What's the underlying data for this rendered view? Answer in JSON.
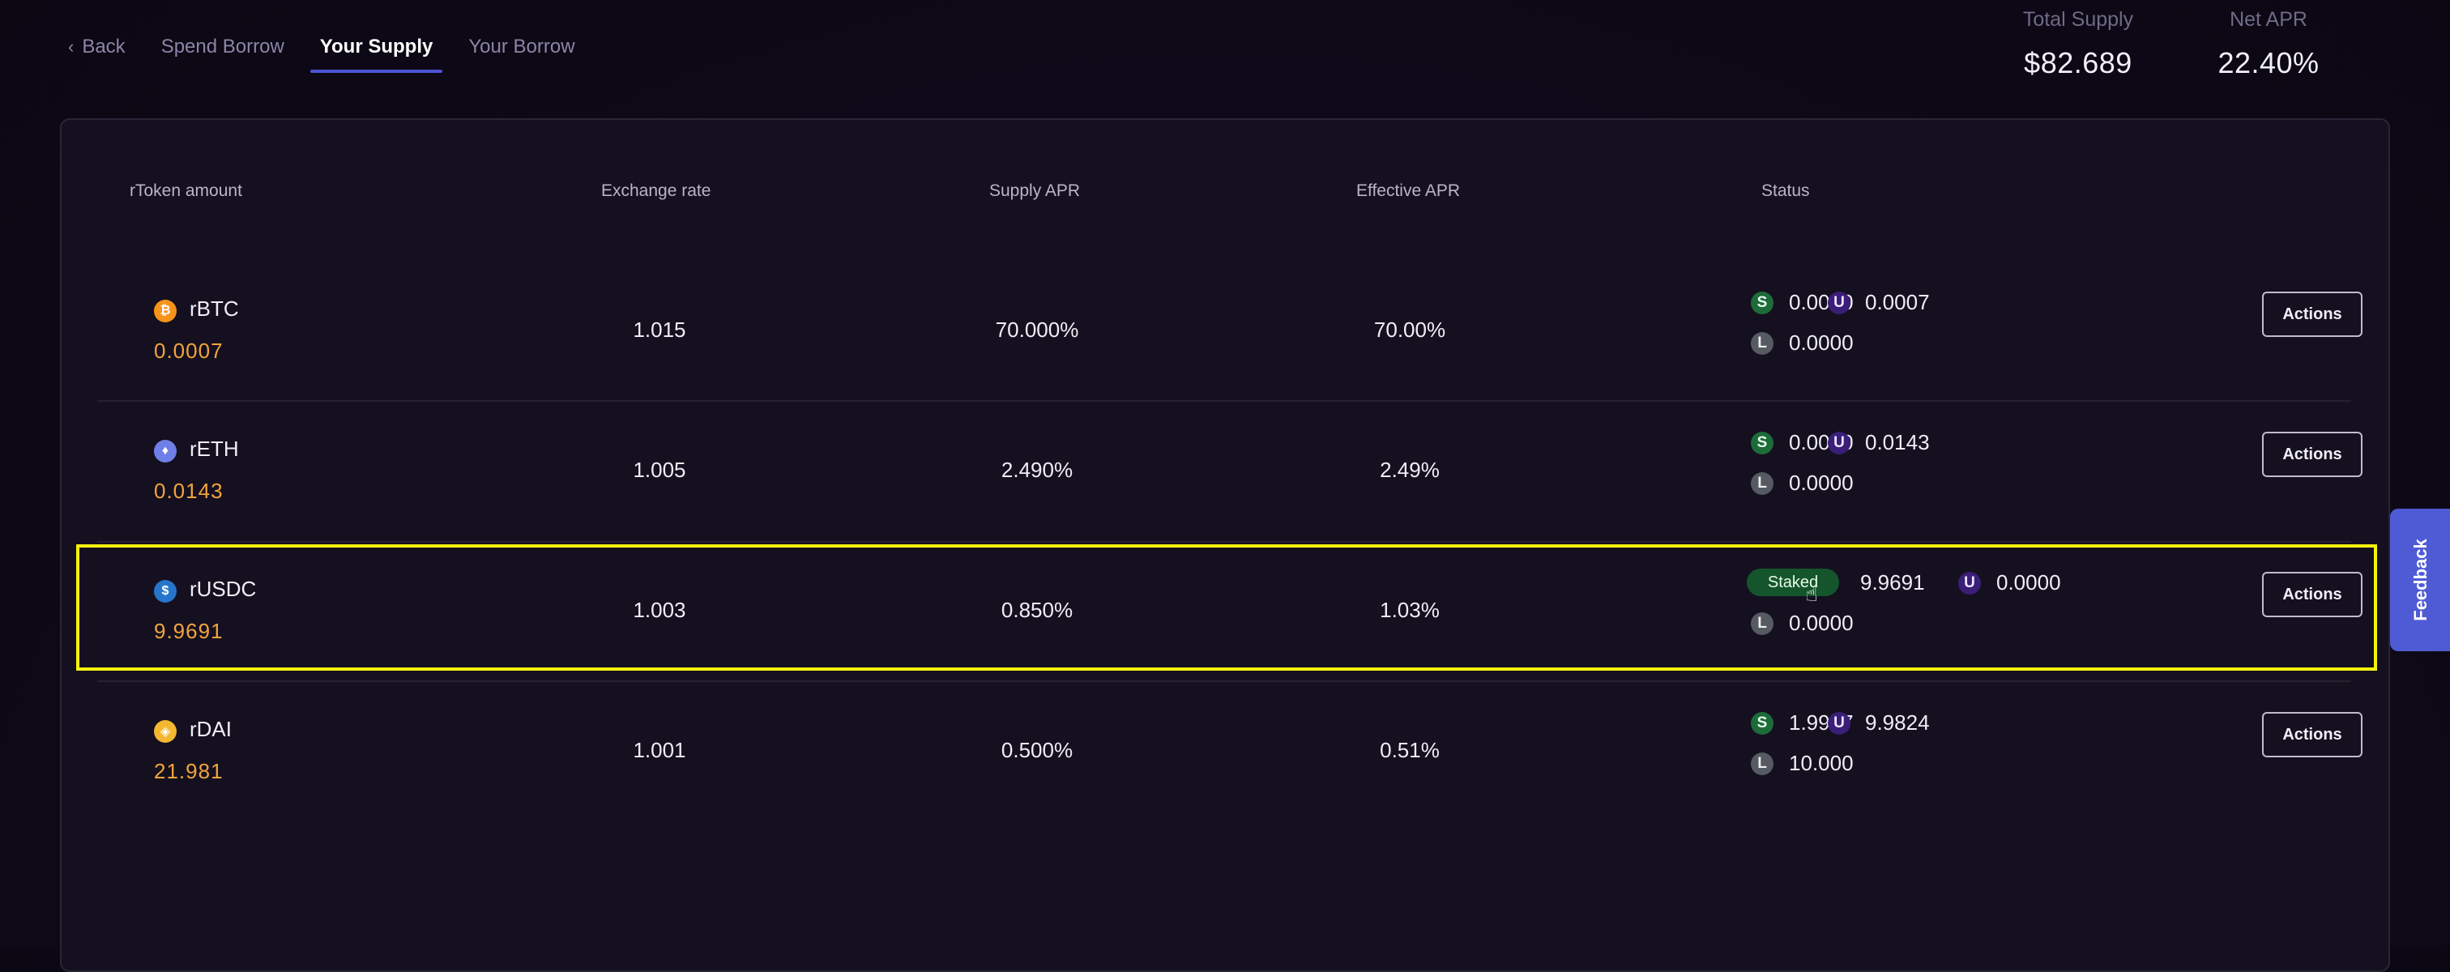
{
  "nav": {
    "back": "Back",
    "tabs": [
      "Spend Borrow",
      "Your Supply",
      "Your Borrow"
    ],
    "active_tab": "Your Supply"
  },
  "stats": {
    "total_supply_label": "Total Supply",
    "total_supply_value": "$82.689",
    "net_apr_label": "Net APR",
    "net_apr_value": "22.40%"
  },
  "table": {
    "headers": [
      "rToken amount",
      "Exchange rate",
      "Supply APR",
      "Effective APR",
      "Status"
    ],
    "rows": [
      {
        "token": "rBTC",
        "amount": "0.0007",
        "icon_color": "#f7931a",
        "icon": "bitcoin-icon",
        "exchange_rate": "1.015",
        "supply_apr": "70.000%",
        "effective_apr": "70.00%",
        "s_label": "S",
        "s": "0.0000",
        "u_label": "U",
        "u": "0.0007",
        "l_label": "L",
        "l": "0.0000",
        "action": "Actions"
      },
      {
        "token": "rETH",
        "amount": "0.0143",
        "icon_color": "#6f7fe8",
        "icon": "ethereum-icon",
        "exchange_rate": "1.005",
        "supply_apr": "2.490%",
        "effective_apr": "2.49%",
        "s_label": "S",
        "s": "0.0000",
        "u_label": "U",
        "u": "0.0143",
        "l_label": "L",
        "l": "0.0000",
        "action": "Actions"
      },
      {
        "token": "rUSDC",
        "amount": "9.9691",
        "icon_color": "#2775ca",
        "icon": "usdc-icon",
        "exchange_rate": "1.003",
        "supply_apr": "0.850%",
        "effective_apr": "1.03%",
        "staked_label": "Staked",
        "s": "9.9691",
        "u_label": "U",
        "u": "0.0000",
        "l_label": "L",
        "l": "0.0000",
        "action": "Actions"
      },
      {
        "token": "rDAI",
        "amount": "21.981",
        "icon_color": "#f4b731",
        "icon": "dai-icon",
        "exchange_rate": "1.001",
        "supply_apr": "0.500%",
        "effective_apr": "0.51%",
        "s_label": "S",
        "s": "1.9987",
        "u_label": "U",
        "u": "9.9824",
        "l_label": "L",
        "l": "10.000",
        "action": "Actions"
      }
    ]
  },
  "feedback": "Feedback",
  "colors": {
    "accent": "#4d55d6",
    "amount": "#f2a43c",
    "highlight": "#f5f20f",
    "staked": "#14552c"
  }
}
